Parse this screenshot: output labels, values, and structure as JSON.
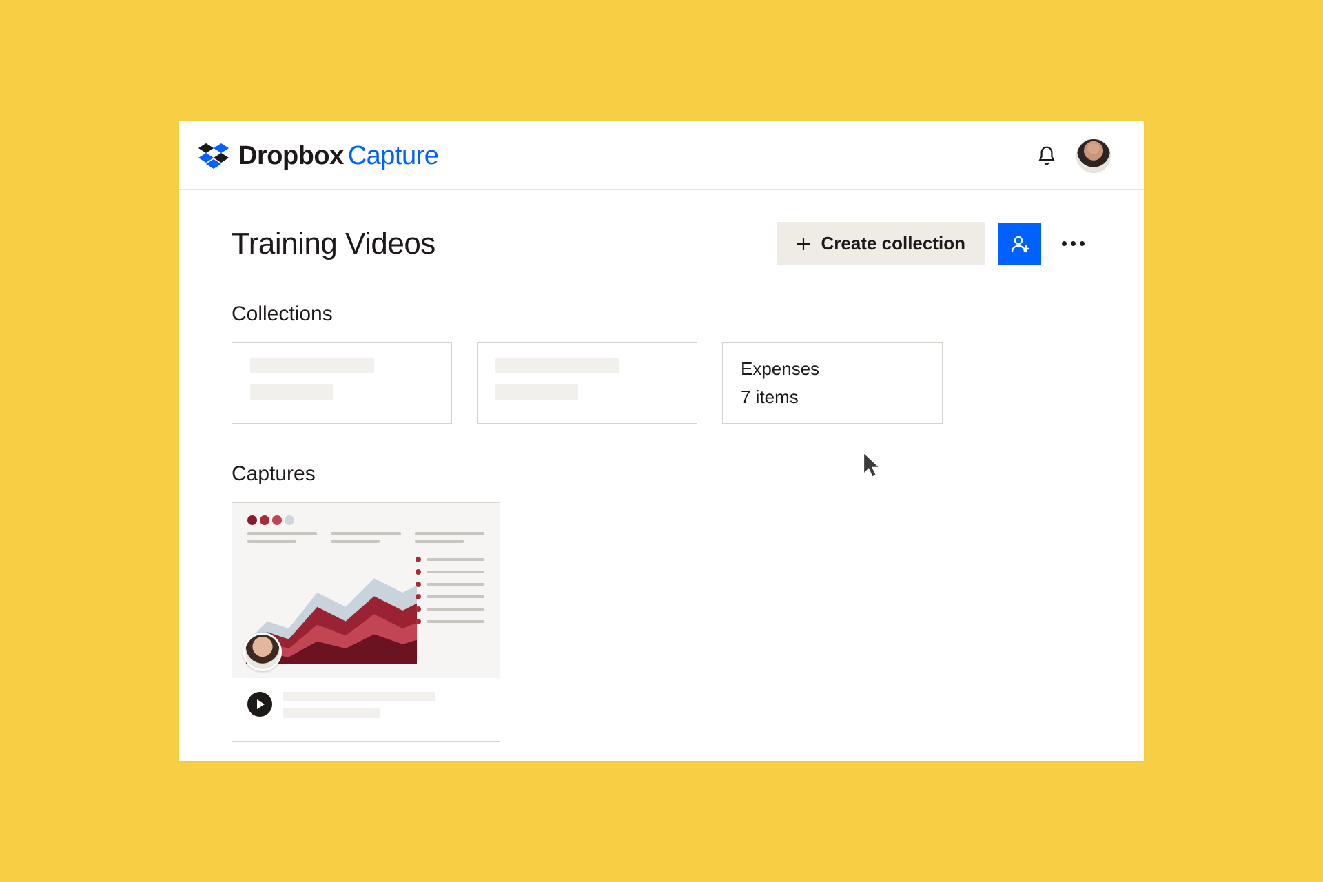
{
  "brand": {
    "name": "Dropbox",
    "product": "Capture"
  },
  "page": {
    "title": "Training Videos"
  },
  "actions": {
    "create_label": "Create collection"
  },
  "sections": {
    "collections": "Collections",
    "captures": "Captures"
  },
  "collections": [
    {
      "placeholder": true
    },
    {
      "placeholder": true
    },
    {
      "placeholder": false,
      "name": "Expenses",
      "meta": "7 items"
    }
  ],
  "colors": {
    "accent": "#0061FE",
    "canvas": "#f7cf45"
  }
}
